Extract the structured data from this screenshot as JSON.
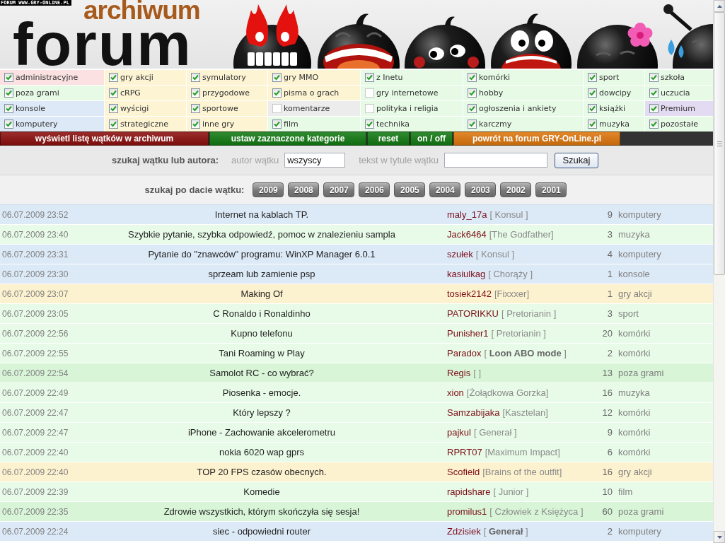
{
  "site_label": "FORUM WWW.GRY-ONLINE.PL",
  "logo": {
    "subtitle": "archiwum",
    "title": "forum"
  },
  "categories": [
    {
      "label": "administracyjne",
      "checked": true,
      "color": "#fbe1e1"
    },
    {
      "label": "gry akcji",
      "checked": true,
      "color": "#fdf4d4"
    },
    {
      "label": "symulatory",
      "checked": true,
      "color": "#fdf4d4"
    },
    {
      "label": "gry MMO",
      "checked": true,
      "color": "#fdf4d4"
    },
    {
      "label": "z Inetu",
      "checked": true,
      "color": "#e6fae6"
    },
    {
      "label": "komórki",
      "checked": true,
      "color": "#e6fae6"
    },
    {
      "label": "sport",
      "checked": true,
      "color": "#e6fae6"
    },
    {
      "label": "szkoła",
      "checked": true,
      "color": "#e6fae6"
    },
    {
      "label": "poza grami",
      "checked": true,
      "color": "#e6fae6"
    },
    {
      "label": "cRPG",
      "checked": true,
      "color": "#fdf4d4"
    },
    {
      "label": "przygodowe",
      "checked": true,
      "color": "#fdf4d4"
    },
    {
      "label": "pisma o grach",
      "checked": true,
      "color": "#fdf4d4"
    },
    {
      "label": "gry internetowe",
      "checked": false,
      "color": "#e6fae6"
    },
    {
      "label": "hobby",
      "checked": true,
      "color": "#e6fae6"
    },
    {
      "label": "dowcipy",
      "checked": true,
      "color": "#e6fae6"
    },
    {
      "label": "uczucia",
      "checked": true,
      "color": "#e6fae6"
    },
    {
      "label": "konsole",
      "checked": true,
      "color": "#dde9f7"
    },
    {
      "label": "wyścigi",
      "checked": true,
      "color": "#fdf4d4"
    },
    {
      "label": "sportowe",
      "checked": true,
      "color": "#fdf4d4"
    },
    {
      "label": "komentarze",
      "checked": false,
      "color": "#ececec"
    },
    {
      "label": "polityka i religia",
      "checked": false,
      "color": "#e6fae6"
    },
    {
      "label": "ogłoszenia i ankiety",
      "checked": true,
      "color": "#e6fae6"
    },
    {
      "label": "książki",
      "checked": true,
      "color": "#e6fae6"
    },
    {
      "label": "Premium",
      "checked": true,
      "color": "#e3dbf1"
    },
    {
      "label": "komputery",
      "checked": true,
      "color": "#dde9f7"
    },
    {
      "label": "strategiczne",
      "checked": true,
      "color": "#fdf4d4"
    },
    {
      "label": "inne gry",
      "checked": true,
      "color": "#fdf4d4"
    },
    {
      "label": "film",
      "checked": true,
      "color": "#e6fae6"
    },
    {
      "label": "technika",
      "checked": true,
      "color": "#e6fae6"
    },
    {
      "label": "karczmy",
      "checked": true,
      "color": "#e6fae6"
    },
    {
      "label": "muzyka",
      "checked": true,
      "color": "#e6fae6"
    },
    {
      "label": "pozostałe",
      "checked": true,
      "color": "#e6fae6"
    }
  ],
  "action_buttons": [
    {
      "label": "wyświetl listę wątków w archiwum",
      "color": "#8c0f0f"
    },
    {
      "label": "ustaw zaznaczone kategorie",
      "color": "#137a13"
    },
    {
      "label": "reset",
      "color": "#137a13"
    },
    {
      "label": "on / off",
      "color": "#137a13"
    },
    {
      "label": "powrót na forum GRY-OnLine.pl",
      "color": "#de760c"
    }
  ],
  "search": {
    "heading": "szukaj wątku lub autora:",
    "author_label": "autor wątku",
    "author_value": "wszyscy",
    "title_label": "tekst w tytule wątku",
    "button": "Szukaj"
  },
  "date_search": {
    "heading": "szukaj po dacie wątku:",
    "years": [
      "2009",
      "2008",
      "2007",
      "2006",
      "2005",
      "2004",
      "2003",
      "2002",
      "2001"
    ]
  },
  "threads": [
    {
      "date": "06.07.2009 23:52",
      "title": "Internet na kablach TP.",
      "author": "maly_17a",
      "rank": "[ Konsul ]",
      "posts": "9",
      "category": "komputery",
      "color": "#dce9f7"
    },
    {
      "date": "06.07.2009 23:40",
      "title": "Szybkie pytanie, szybka odpowiedź, pomoc w znalezieniu sampla",
      "author": "Jack6464",
      "rank": "[The Godfather]",
      "posts": "3",
      "category": "muzyka",
      "color": "#e8fbe8"
    },
    {
      "date": "06.07.2009 23:31",
      "title": "Pytanie do \"znawców\" programu: WinXP Manager 6.0.1",
      "author": "szułek",
      "rank": "[ Konsul ]",
      "posts": "4",
      "category": "komputery",
      "color": "#dce9f7"
    },
    {
      "date": "06.07.2009 23:30",
      "title": "sprzeam lub zamienie psp",
      "author": "kasiulkag",
      "rank": "[ Chorąży ]",
      "posts": "1",
      "category": "konsole",
      "color": "#dce9f7"
    },
    {
      "date": "06.07.2009 23:07",
      "title": "Making Of",
      "author": "tosiek2142",
      "rank": "[Fixxxer]",
      "posts": "1",
      "category": "gry akcji",
      "color": "#fdf2cf"
    },
    {
      "date": "06.07.2009 23:05",
      "title": "C Ronaldo i Ronaldinho",
      "author": "PATORIKKU",
      "rank": "[ Pretorianin ]",
      "posts": "3",
      "category": "sport",
      "color": "#e8fbe8"
    },
    {
      "date": "06.07.2009 22:56",
      "title": "Kupno telefonu",
      "author": "Punisher1",
      "rank": "[ Pretorianin ]",
      "posts": "20",
      "category": "komórki",
      "color": "#e8fbe8"
    },
    {
      "date": "06.07.2009 22:55",
      "title": "Tani Roaming w Play",
      "author": "Paradox",
      "rank": "[ **Loon ABO mode** ]",
      "posts": "2",
      "category": "komórki",
      "color": "#e8fbe8"
    },
    {
      "date": "06.07.2009 22:54",
      "title": "Samolot RC - co wybrać?",
      "author": "Regis",
      "rank": "[ ]",
      "posts": "13",
      "category": "poza grami",
      "color": "#d8f5d8"
    },
    {
      "date": "06.07.2009 22:49",
      "title": "Piosenka - emocje.",
      "author": "xion",
      "rank": "[Żołądkowa Gorzka]",
      "posts": "16",
      "category": "muzyka",
      "color": "#e8fbe8"
    },
    {
      "date": "06.07.2009 22:47",
      "title": "Który lepszy ?",
      "author": "Samzabijaka",
      "rank": "[Kasztelan]",
      "posts": "12",
      "category": "komórki",
      "color": "#e8fbe8"
    },
    {
      "date": "06.07.2009 22:47",
      "title": "iPhone - Zachowanie akcelerometru",
      "author": "pajkul",
      "rank": "[ Generał ]",
      "posts": "9",
      "category": "komórki",
      "color": "#e8fbe8"
    },
    {
      "date": "06.07.2009 22:40",
      "title": "nokia 6020 wap gprs",
      "author": "RPRT07",
      "rank": "[Maximum Impact]",
      "posts": "6",
      "category": "komórki",
      "color": "#e8fbe8"
    },
    {
      "date": "06.07.2009 22:40",
      "title": "TOP 20 FPS czasów obecnych.",
      "author": "Scofield",
      "rank": "[Brains of the outfit]",
      "posts": "16",
      "category": "gry akcji",
      "color": "#fdf2cf"
    },
    {
      "date": "06.07.2009 22:39",
      "title": "Komedie",
      "author": "rapidshare",
      "rank": "[ Junior ]",
      "posts": "10",
      "category": "film",
      "color": "#e8fbe8"
    },
    {
      "date": "06.07.2009 22:35",
      "title": "Zdrowie wszystkich, którym skończyła się sesja!",
      "author": "promilus1",
      "rank": "[ Człowiek z Księżyca ]",
      "posts": "60",
      "category": "poza grami",
      "color": "#d8f5d8"
    },
    {
      "date": "06.07.2009 22:24",
      "title": "siec - odpowiedni router",
      "author": "Zdzisiek",
      "rank": "[ **Generał** ]",
      "posts": "2",
      "category": "komputery",
      "color": "#dce9f7"
    }
  ]
}
